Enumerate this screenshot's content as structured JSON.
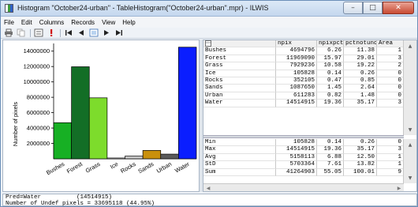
{
  "window": {
    "title": "Histogram \"October24-urban\" - TableHistogram(\"October24-urban\".mpr) - ILWIS",
    "buttons": {
      "minimize": "–",
      "maximize": "□",
      "close": "✕"
    }
  },
  "menu": [
    "File",
    "Edit",
    "Columns",
    "Records",
    "View",
    "Help"
  ],
  "toolbar": {
    "icons": [
      "print-icon",
      "copy-icon",
      "properties-icon",
      "exclamation-icon",
      "first-record-icon",
      "previous-record-icon",
      "goto-record-icon",
      "next-record-icon",
      "last-record-icon"
    ]
  },
  "chart_data": {
    "type": "bar",
    "categories": [
      "Bushes",
      "Forest",
      "Grass",
      "Ice",
      "Rocks",
      "Sands",
      "Urban",
      "Water"
    ],
    "values": [
      4694796,
      11969090,
      7929236,
      105828,
      352105,
      1087650,
      611283,
      14514915
    ],
    "colors": [
      "#17b024",
      "#136e26",
      "#7ddc2c",
      "#ffffff",
      "#c8c8c8",
      "#c9900c",
      "#5a5a5a",
      "#0a1eff"
    ],
    "ylabel": "Number of pixels",
    "ylim": [
      0,
      15000000
    ],
    "yticks": [
      "2000000",
      "4000000",
      "6000000",
      "8000000",
      "10000000",
      "12000000",
      "14000000"
    ],
    "ytick_values": [
      2000000,
      4000000,
      6000000,
      8000000,
      10000000,
      12000000,
      14000000
    ]
  },
  "table": {
    "columns": [
      "",
      "npix",
      "npixpct",
      "pctnotund",
      "Area"
    ],
    "rows": [
      [
        "Bushes",
        "4694796",
        "6.26",
        "11.38",
        "1"
      ],
      [
        "Forest",
        "11969090",
        "15.97",
        "29.01",
        "3"
      ],
      [
        "Grass",
        "7929236",
        "10.58",
        "19.22",
        "2"
      ],
      [
        "Ice",
        "105828",
        "0.14",
        "0.26",
        "0"
      ],
      [
        "Rocks",
        "352105",
        "0.47",
        "0.85",
        "0"
      ],
      [
        "Sands",
        "1087650",
        "1.45",
        "2.64",
        "0"
      ],
      [
        "Urban",
        "611283",
        "0.82",
        "1.48",
        "0"
      ],
      [
        "Water",
        "14514915",
        "19.36",
        "35.17",
        "3"
      ]
    ],
    "summary": [
      [
        "Min",
        "105828",
        "0.14",
        "0.26",
        "0"
      ],
      [
        "Max",
        "14514915",
        "19.36",
        "35.17",
        "3"
      ],
      [
        "Avg",
        "5158113",
        "6.88",
        "12.50",
        "1"
      ],
      [
        "StD",
        "5703364",
        "7.61",
        "13.82",
        "1"
      ],
      [
        "Sum",
        "41264903",
        "55.05",
        "100.01",
        "9"
      ]
    ]
  },
  "status": {
    "line1": "Pred=Water          (14514915)",
    "line2": "Number of Undef pixels = 33695118 (44.95%)"
  }
}
